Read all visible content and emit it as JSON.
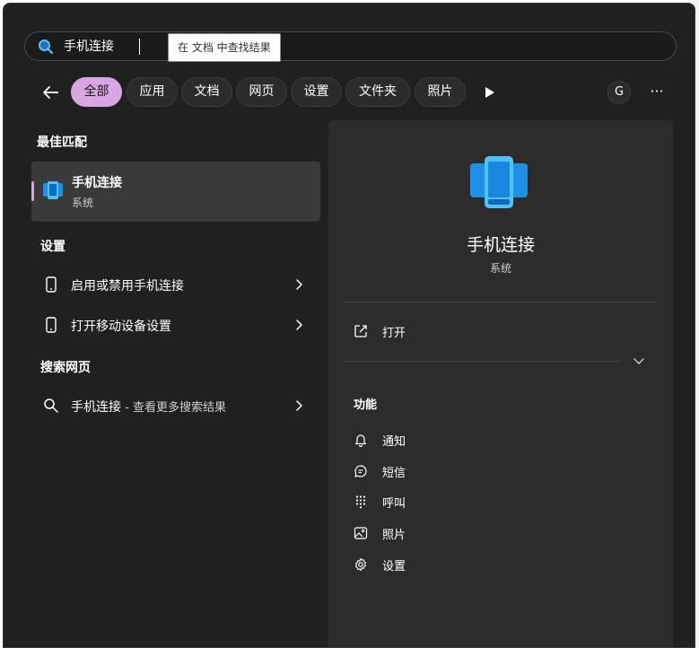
{
  "search": {
    "query": "手机连接",
    "tooltip": "在 文档 中查找结果"
  },
  "filters": {
    "items": [
      "全部",
      "应用",
      "文档",
      "网页",
      "设置",
      "文件夹",
      "照片"
    ],
    "active_index": 0,
    "avatar_letter": "G",
    "more_label": "···"
  },
  "left": {
    "best_match_title": "最佳匹配",
    "best_match": {
      "title": "手机连接",
      "subtitle": "系统"
    },
    "settings_title": "设置",
    "settings_items": [
      "启用或禁用手机连接",
      "打开移动设备设置"
    ],
    "web_title": "搜索网页",
    "web_item": {
      "query": "手机连接",
      "suffix": " - 查看更多搜索结果"
    }
  },
  "detail": {
    "title": "手机连接",
    "subtitle": "系统",
    "open_label": "打开",
    "features_title": "功能",
    "features": [
      {
        "label": "通知",
        "icon": "bell-icon"
      },
      {
        "label": "短信",
        "icon": "chat-icon"
      },
      {
        "label": "呼叫",
        "icon": "dialpad-icon"
      },
      {
        "label": "照片",
        "icon": "image-icon"
      },
      {
        "label": "设置",
        "icon": "gear-icon"
      }
    ]
  },
  "colors": {
    "panel": "#202020",
    "accent": "#d8a6e0",
    "detail_panel": "#2c2c2c",
    "app_icon_blue": "#1e90e6"
  }
}
